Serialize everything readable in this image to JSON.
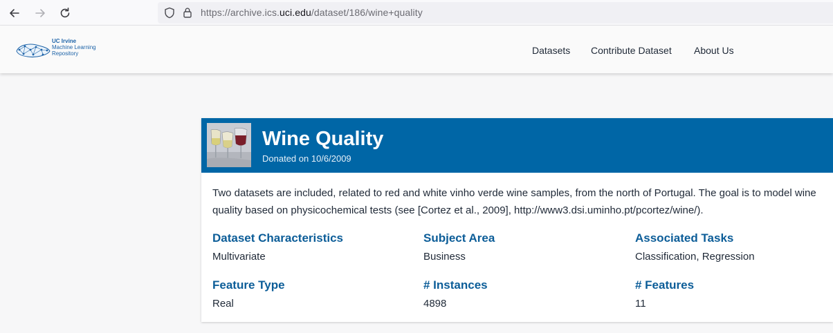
{
  "browser": {
    "url_prefix": "https://archive.ics.",
    "url_domain": "uci.edu",
    "url_path": "/dataset/186/wine+quality",
    "icons": [
      "back-arrow-icon",
      "forward-arrow-icon",
      "reload-icon",
      "shield-icon",
      "lock-icon"
    ]
  },
  "site": {
    "logo": {
      "line1": "UC Irvine",
      "line2": "Machine Learning",
      "line3": "Repository"
    },
    "nav": [
      "Datasets",
      "Contribute Dataset",
      "About Us"
    ]
  },
  "dataset": {
    "title": "Wine Quality",
    "donated": "Donated on 10/6/2009",
    "description": "Two datasets are included, related to red and white vinho verde wine samples, from the north of Portugal. The goal is to model wine quality based on physicochemical tests (see [Cortez et al., 2009], http://www3.dsi.uminho.pt/pcortez/wine/).",
    "attributes": [
      {
        "label": "Dataset Characteristics",
        "value": "Multivariate"
      },
      {
        "label": "Subject Area",
        "value": "Business"
      },
      {
        "label": "Associated Tasks",
        "value": "Classification, Regression"
      },
      {
        "label": "Feature Type",
        "value": "Real"
      },
      {
        "label": "# Instances",
        "value": "4898"
      },
      {
        "label": "# Features",
        "value": "11"
      }
    ]
  },
  "colors": {
    "banner": "#0066a6",
    "heading": "#0c5d98"
  }
}
